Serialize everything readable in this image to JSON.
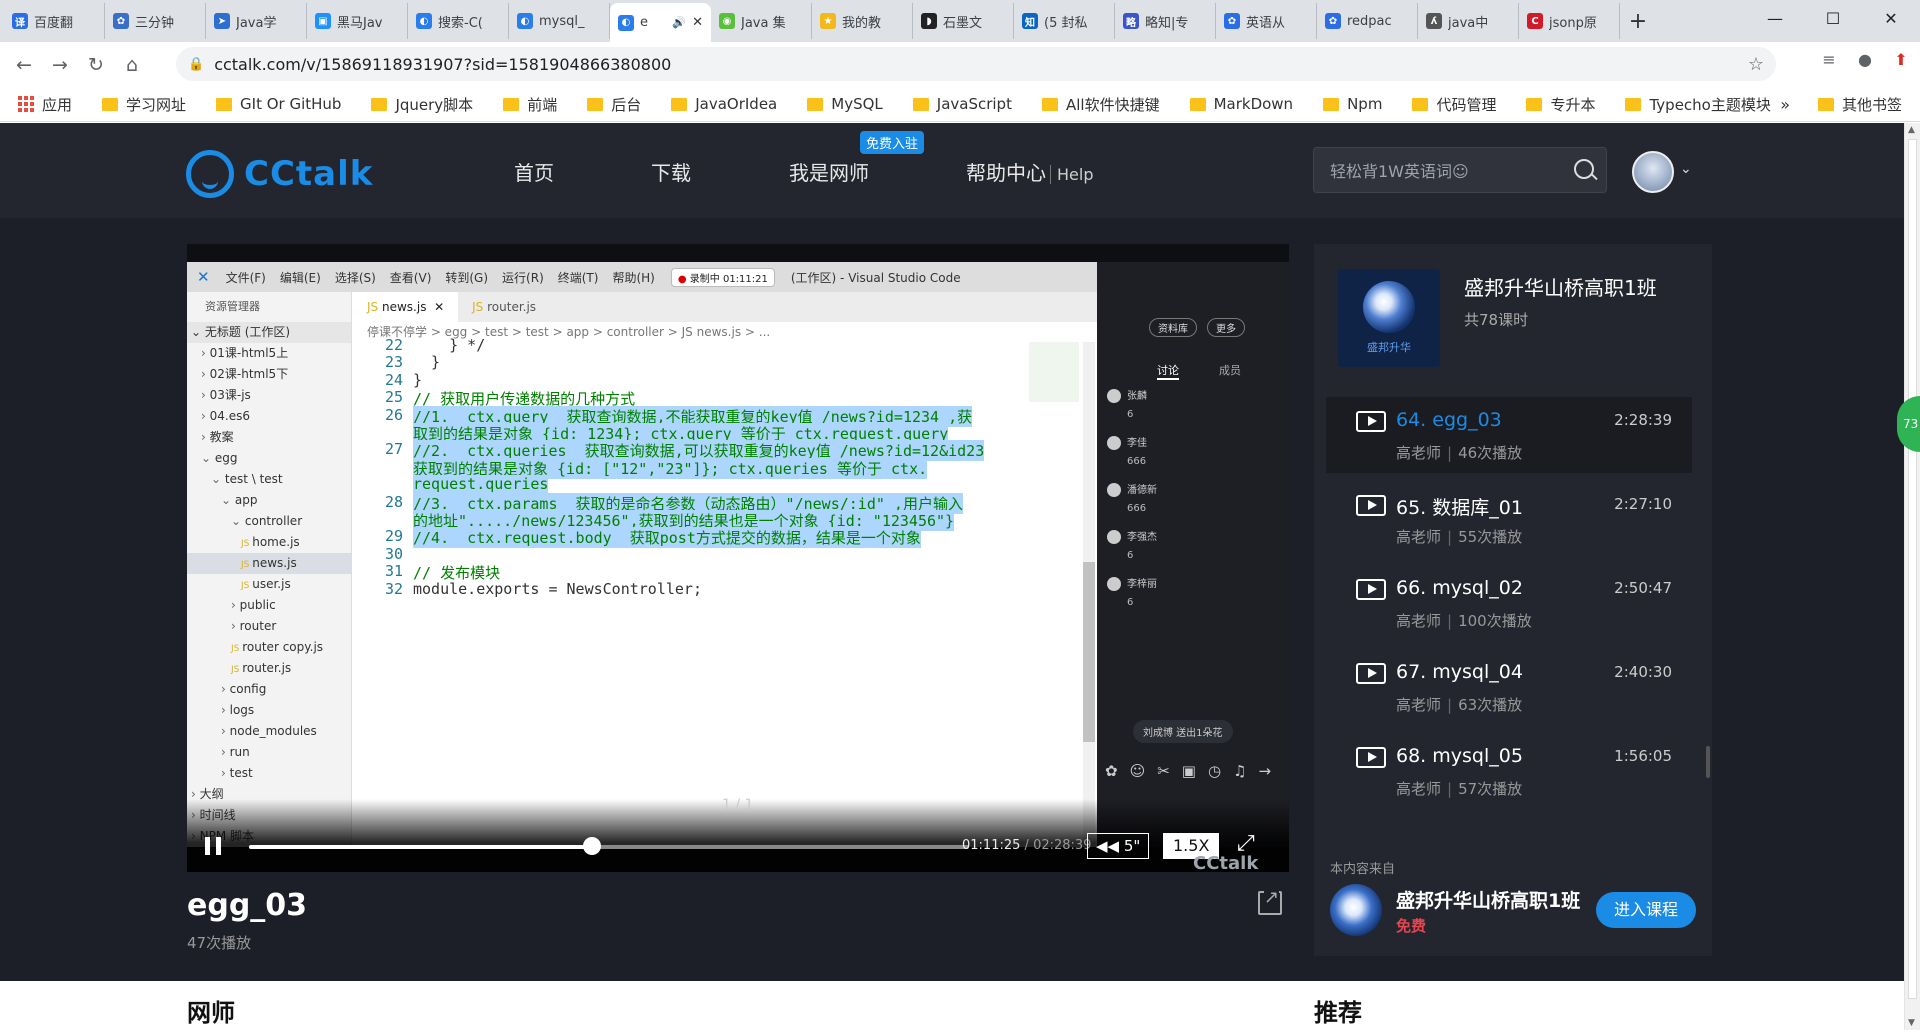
{
  "browser": {
    "tabs": [
      {
        "title": "百度翻",
        "fav_color": "#2b6de5",
        "fav_glyph": "译"
      },
      {
        "title": "三分钟",
        "fav_color": "#3a6fc8",
        "fav_glyph": "✿"
      },
      {
        "title": "Java学",
        "fav_color": "#2d6fd0",
        "fav_glyph": "➤"
      },
      {
        "title": "黑马Jav",
        "fav_color": "#1e90ff",
        "fav_glyph": "▣"
      },
      {
        "title": "搜索-C(",
        "fav_color": "#2b7de9",
        "fav_glyph": "◐"
      },
      {
        "title": "mysql_",
        "fav_color": "#2b7de9",
        "fav_glyph": "◐"
      },
      {
        "title": "e",
        "fav_color": "#2b7de9",
        "fav_glyph": "◐",
        "active": true
      },
      {
        "title": "Java 集",
        "fav_color": "#5bbf3e",
        "fav_glyph": "◉"
      },
      {
        "title": "我的教",
        "fav_color": "#f3b81b",
        "fav_glyph": "★"
      },
      {
        "title": "石墨文",
        "fav_color": "#222222",
        "fav_glyph": "◗"
      },
      {
        "title": "(5 封私",
        "fav_color": "#0a66c2",
        "fav_glyph": "知"
      },
      {
        "title": "略知|专",
        "fav_color": "#3a55c9",
        "fav_glyph": "略"
      },
      {
        "title": "英语从",
        "fav_color": "#2b6de5",
        "fav_glyph": "✿"
      },
      {
        "title": "redpac",
        "fav_color": "#2b6de5",
        "fav_glyph": "✿"
      },
      {
        "title": "java中",
        "fav_color": "#555555",
        "fav_glyph": "ʎ"
      },
      {
        "title": "jsonp原",
        "fav_color": "#d11a2a",
        "fav_glyph": "C"
      }
    ],
    "url": "cctalk.com/v/15869118931907?sid=1581904866380800",
    "bookmarks": [
      "应用",
      "学习网址",
      "GIt Or GitHub",
      "Jquery脚本",
      "前端",
      "后台",
      "JavaOrIdea",
      "MySQL",
      "JavaScript",
      "All软件快捷键",
      "MarkDown",
      "Npm",
      "代码管理",
      "专升本",
      "Typecho主题模块"
    ],
    "bookmarks_more": "»",
    "other_bookmarks": "其他书签"
  },
  "site": {
    "logo_text": "CCtalk",
    "nav": [
      "首页",
      "下载",
      "我是网师",
      "帮助中心"
    ],
    "nav_help_suffix": "Help",
    "nav_badge": "免费入驻",
    "search_placeholder": "轻松背1W英语词☺"
  },
  "editor": {
    "menu": [
      "文件(F)",
      "编辑(E)",
      "选择(S)",
      "查看(V)",
      "转到(G)",
      "运行(R)",
      "终端(T)",
      "帮助(H)"
    ],
    "rec_label": "录制中",
    "rec_time": "01:11:21",
    "window_title": "(工作区) - Visual Studio Code",
    "explorer_title": "资源管理器",
    "workspace": "无标题 (工作区)",
    "tree": [
      {
        "label": "01课-html5上",
        "indent": 1
      },
      {
        "label": "02课-html5下",
        "indent": 1
      },
      {
        "label": "03课-js",
        "indent": 1
      },
      {
        "label": "04.es6",
        "indent": 1
      },
      {
        "label": "教案",
        "indent": 1
      },
      {
        "label": "egg",
        "indent": 1,
        "open": true
      },
      {
        "label": "test \\ test",
        "indent": 2,
        "open": true
      },
      {
        "label": "app",
        "indent": 3,
        "open": true
      },
      {
        "label": "controller",
        "indent": 4,
        "open": true
      },
      {
        "label": "home.js",
        "indent": 5,
        "file": true
      },
      {
        "label": "news.js",
        "indent": 5,
        "file": true,
        "selected": true
      },
      {
        "label": "user.js",
        "indent": 5,
        "file": true
      },
      {
        "label": "public",
        "indent": 4
      },
      {
        "label": "router",
        "indent": 4
      },
      {
        "label": "router copy.js",
        "indent": 4,
        "file": true
      },
      {
        "label": "router.js",
        "indent": 4,
        "file": true
      },
      {
        "label": "config",
        "indent": 3
      },
      {
        "label": "logs",
        "indent": 3
      },
      {
        "label": "node_modules",
        "indent": 3
      },
      {
        "label": "run",
        "indent": 3
      },
      {
        "label": "test",
        "indent": 3
      },
      {
        "label": "大纲",
        "indent": 0
      },
      {
        "label": "时间线",
        "indent": 0
      },
      {
        "label": "NPM 脚本",
        "indent": 0
      }
    ],
    "tabs": [
      "news.js",
      "router.js"
    ],
    "breadcrumb": "停课不停学 > egg > test > test > app > controller > JS news.js > ...",
    "code": [
      {
        "n": "22",
        "text": "    } */",
        "kind": "plain"
      },
      {
        "n": "23",
        "text": "  }",
        "kind": "plain"
      },
      {
        "n": "24",
        "text": "}",
        "kind": "plain"
      },
      {
        "n": "25",
        "text": "// 获取用户传递数据的几种方式",
        "kind": "comment"
      },
      {
        "n": "26",
        "text": "//1.  ctx.query  获取查询数据,不能获取重复的key值 /news?id=1234 ,获",
        "kind": "sel"
      },
      {
        "n": "",
        "text": "取到的结果是对象 {id: 1234}; ctx.query 等价于 ctx.request.query",
        "kind": "sel"
      },
      {
        "n": "27",
        "text": "//2.  ctx.queries  获取查询数据,可以获取重复的key值 /news?id=12&id23",
        "kind": "sel"
      },
      {
        "n": "",
        "text": "获取到的结果是对象 {id: [\"12\",\"23\"]}; ctx.queries 等价于 ctx.",
        "kind": "sel"
      },
      {
        "n": "",
        "text": "request.queries",
        "kind": "sel"
      },
      {
        "n": "28",
        "text": "//3.  ctx.params  获取的是命名参数（动态路由）\"/news/:id\" ,用户输入",
        "kind": "sel"
      },
      {
        "n": "",
        "text": "的地址\"...../news/123456\",获取到的结果也是一个对象 {id: \"123456\"}",
        "kind": "sel"
      },
      {
        "n": "29",
        "text": "//4.  ctx.request.body  获取post方式提交的数据，结果是一个对象",
        "kind": "sel"
      },
      {
        "n": "30",
        "text": "",
        "kind": "plain"
      },
      {
        "n": "31",
        "text": "// 发布模块",
        "kind": "comment"
      },
      {
        "n": "32",
        "text": "module.exports = NewsController;",
        "kind": "plain"
      }
    ]
  },
  "live_chat": {
    "tags": [
      "资料库",
      "更多"
    ],
    "tabs": [
      "讨论",
      "成员"
    ],
    "messages": [
      {
        "user": "张麟",
        "text": "6"
      },
      {
        "user": "李佳",
        "text": "666"
      },
      {
        "user": "潘德新",
        "text": "666"
      },
      {
        "user": "李强杰",
        "text": "6"
      },
      {
        "user": "李梓丽",
        "text": "6"
      }
    ],
    "flower_notice": "刘成博 送出1朵花"
  },
  "player": {
    "page_indicator": "1 / 1",
    "current_time": "01:11:25",
    "total_time": "02:28:39",
    "progress": 0.477,
    "rewind_label": "◀◀ 5\"",
    "speed": "1.5X",
    "watermark": "CCtalk"
  },
  "video": {
    "title": "egg_03",
    "plays": "47次播放"
  },
  "course": {
    "name": "盛邦升华山桥高职1班",
    "lesson_count": "共78课时",
    "cover_caption": "盛邦升华",
    "lessons": [
      {
        "title": "64. egg_03",
        "duration": "2:28:39",
        "teacher": "高老师",
        "plays": "46次播放",
        "current": true
      },
      {
        "title": "65. 数据库_01",
        "duration": "2:27:10",
        "teacher": "高老师",
        "plays": "55次播放"
      },
      {
        "title": "66. mysql_02",
        "duration": "2:50:47",
        "teacher": "高老师",
        "plays": "100次播放"
      },
      {
        "title": "67. mysql_04",
        "duration": "2:40:30",
        "teacher": "高老师",
        "plays": "63次播放"
      },
      {
        "title": "68. mysql_05",
        "duration": "1:56:05",
        "teacher": "高老师",
        "plays": "57次播放"
      }
    ],
    "from_label": "本内容来自",
    "from_name": "盛邦升华山桥高职1班",
    "from_price": "免费",
    "enter_label": "进入课程"
  },
  "lower": {
    "teacher_heading": "网师",
    "recommend_heading": "推荐"
  },
  "floating_badge": "73"
}
